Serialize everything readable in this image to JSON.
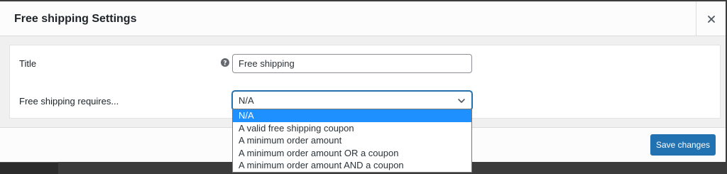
{
  "modal": {
    "title": "Free shipping Settings",
    "close_icon": "close-icon"
  },
  "form": {
    "title_label": "Title",
    "title_value": "Free shipping",
    "help_icon": "help-icon",
    "requires_label": "Free shipping requires...",
    "requires_selected": "N/A",
    "requires_options": [
      "N/A",
      "A valid free shipping coupon",
      "A minimum order amount",
      "A minimum order amount OR a coupon",
      "A minimum order amount AND a coupon"
    ]
  },
  "footer": {
    "save_label": "Save changes"
  },
  "colors": {
    "accent": "#2271b1",
    "selected_option": "#1e90ff",
    "overlay": "#3c3c3c"
  }
}
